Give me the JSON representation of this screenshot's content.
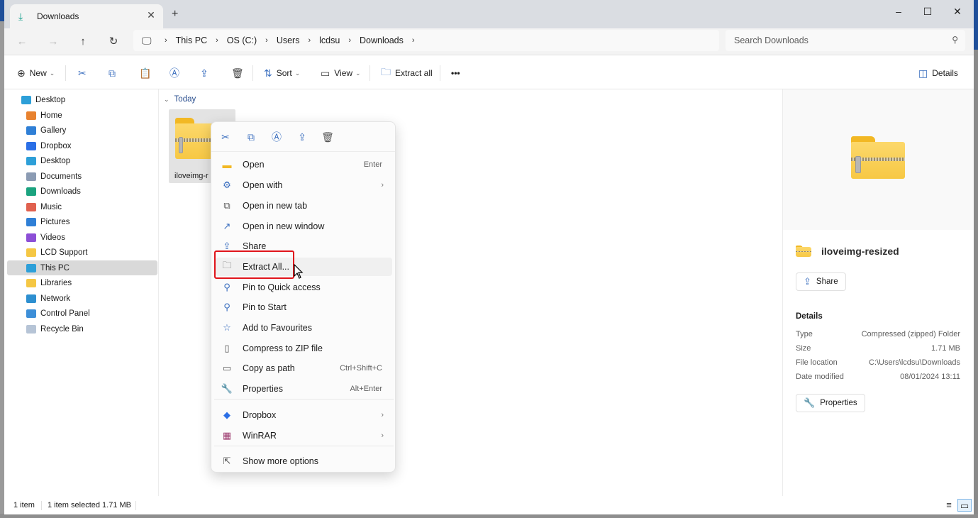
{
  "window": {
    "tab": {
      "icon": "download-icon",
      "label": "Downloads"
    },
    "controls": {
      "minimize": "–",
      "maximize": "☐",
      "close": "✕"
    }
  },
  "nav": {
    "back": "←",
    "forward": "→",
    "up": "↑",
    "refresh": "↻",
    "breadcrumb": [
      "This PC",
      "OS (C:)",
      "Users",
      "lcdsu",
      "Downloads"
    ],
    "search_placeholder": "Search Downloads"
  },
  "toolbar": {
    "new_label": "New",
    "sort_label": "Sort",
    "view_label": "View",
    "extract_all_label": "Extract all",
    "more_label": "•••",
    "details_label": "Details"
  },
  "sidebar": {
    "items": [
      {
        "label": "Desktop",
        "icon": "desktop-icon",
        "color": "#2d9fd8"
      },
      {
        "label": "Home",
        "icon": "home-icon",
        "color": "#e8822f"
      },
      {
        "label": "Gallery",
        "icon": "gallery-icon",
        "color": "#2f7fd6"
      },
      {
        "label": "Dropbox",
        "icon": "dropbox-icon",
        "color": "#2b6fe6"
      },
      {
        "label": "Desktop",
        "icon": "desktop-icon",
        "color": "#2d9fd8"
      },
      {
        "label": "Documents",
        "icon": "documents-icon",
        "color": "#8b9bb3"
      },
      {
        "label": "Downloads",
        "icon": "downloads-icon",
        "color": "#1ba37f"
      },
      {
        "label": "Music",
        "icon": "music-icon",
        "color": "#e0614f"
      },
      {
        "label": "Pictures",
        "icon": "pictures-icon",
        "color": "#2f7fd6"
      },
      {
        "label": "Videos",
        "icon": "videos-icon",
        "color": "#8c4fd6"
      },
      {
        "label": "LCD Support",
        "icon": "folder-icon",
        "color": "#f5c744"
      },
      {
        "label": "This PC",
        "icon": "this-pc-icon",
        "color": "#2d9fd8"
      },
      {
        "label": "Libraries",
        "icon": "libraries-icon",
        "color": "#f5c744"
      },
      {
        "label": "Network",
        "icon": "network-icon",
        "color": "#2d8fd0"
      },
      {
        "label": "Control Panel",
        "icon": "control-panel-icon",
        "color": "#3d8fd8"
      },
      {
        "label": "Recycle Bin",
        "icon": "recycle-bin-icon",
        "color": "#b6c4d6"
      }
    ],
    "selected_index": 11
  },
  "content": {
    "group_label": "Today",
    "file": {
      "name_truncated": "iloveimg-r"
    }
  },
  "context_menu": {
    "quick_actions": [
      "cut",
      "copy",
      "rename",
      "share",
      "delete"
    ],
    "items": [
      {
        "label": "Open",
        "shortcut": "Enter",
        "icon": "folder-open-icon"
      },
      {
        "label": "Open with",
        "submenu": "›",
        "icon": "open-with-icon"
      },
      {
        "label": "Open in new tab",
        "icon": "new-tab-icon"
      },
      {
        "label": "Open in new window",
        "icon": "new-window-icon"
      },
      {
        "label": "Share",
        "icon": "share-icon"
      },
      {
        "label": "Extract All...",
        "icon": "extract-icon"
      },
      {
        "label": "Pin to Quick access",
        "icon": "pin-icon"
      },
      {
        "label": "Pin to Start",
        "icon": "pin-icon"
      },
      {
        "label": "Add to Favourites",
        "icon": "star-icon"
      },
      {
        "label": "Compress to ZIP file",
        "icon": "zip-icon"
      },
      {
        "label": "Copy as path",
        "shortcut": "Ctrl+Shift+C",
        "icon": "copy-path-icon"
      },
      {
        "label": "Properties",
        "shortcut": "Alt+Enter",
        "icon": "wrench-icon"
      },
      {
        "label": "Dropbox",
        "submenu": "›",
        "icon": "dropbox-icon"
      },
      {
        "label": "WinRAR",
        "submenu": "›",
        "icon": "winrar-icon"
      },
      {
        "label": "Show more options",
        "icon": "more-options-icon"
      }
    ],
    "highlighted_index": 5
  },
  "details": {
    "name": "iloveimg-resized",
    "share_label": "Share",
    "section_label": "Details",
    "rows": [
      {
        "key": "Type",
        "value": "Compressed (zipped) Folder"
      },
      {
        "key": "Size",
        "value": "1.71 MB"
      },
      {
        "key": "File location",
        "value": "C:\\Users\\lcdsu\\Downloads"
      },
      {
        "key": "Date modified",
        "value": "08/01/2024 13:11"
      }
    ],
    "properties_label": "Properties"
  },
  "status": {
    "count": "1 item",
    "selection": "1 item selected  1.71 MB"
  }
}
